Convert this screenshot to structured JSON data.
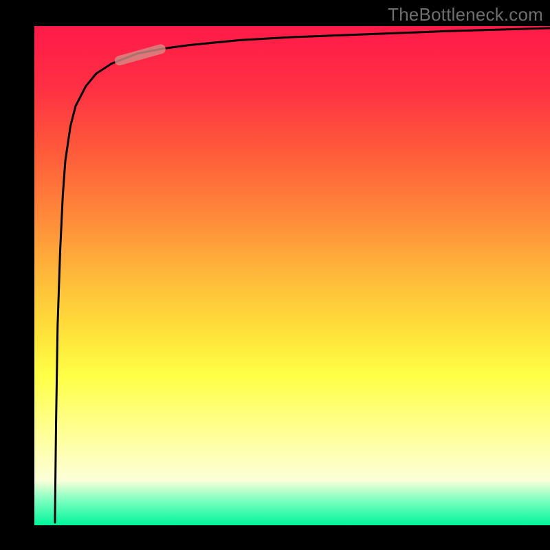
{
  "watermark": "TheBottleneck.com",
  "colors": {
    "curve": "#000000",
    "vertical_line": "#000000",
    "marker": "#d58c86",
    "gradient_stops": [
      "#ff1a48",
      "#ff2f44",
      "#ff5a3a",
      "#ff893a",
      "#ffb93a",
      "#ffe43a",
      "#ffff46",
      "#ffffa8",
      "#fbffd8",
      "#7cffc0",
      "#00f59a"
    ]
  },
  "chart_data": {
    "type": "line",
    "title": "",
    "xlabel": "",
    "ylabel": "",
    "x": [
      0.04,
      0.042,
      0.045,
      0.05,
      0.055,
      0.06,
      0.07,
      0.08,
      0.1,
      0.12,
      0.15,
      0.2,
      0.25,
      0.3,
      0.4,
      0.5,
      0.6,
      0.7,
      0.8,
      0.9,
      1.0
    ],
    "values": [
      0.02,
      0.2,
      0.4,
      0.55,
      0.66,
      0.73,
      0.8,
      0.84,
      0.88,
      0.905,
      0.925,
      0.945,
      0.955,
      0.962,
      0.972,
      0.978,
      0.982,
      0.986,
      0.99,
      0.993,
      0.996
    ],
    "xlim": [
      0,
      1
    ],
    "ylim": [
      0,
      1
    ],
    "marker": {
      "x_range": [
        0.165,
        0.245
      ],
      "y_range": [
        0.93,
        0.955
      ],
      "style": "capsule"
    },
    "vertical_line_x": 0.04
  }
}
